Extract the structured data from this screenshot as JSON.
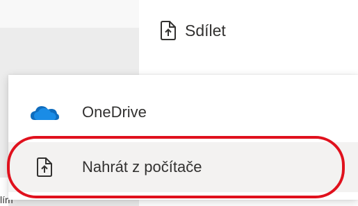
{
  "toolbar": {
    "share_label": "Sdílet",
    "share_icon": "share-upload-icon"
  },
  "menu": {
    "items": [
      {
        "label": "OneDrive",
        "icon": "onedrive-cloud-icon"
      },
      {
        "label": "Nahrát z počítače",
        "icon": "upload-file-icon"
      }
    ]
  },
  "background": {
    "partial_text": "lím"
  },
  "annotation": {
    "highlight_color": "#e0111d"
  }
}
